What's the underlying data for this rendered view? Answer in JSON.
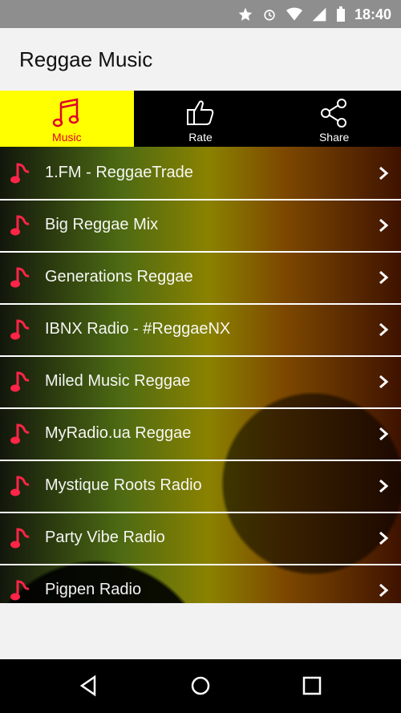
{
  "status": {
    "time": "18:40"
  },
  "app": {
    "title": "Reggae Music"
  },
  "tabs": [
    {
      "label": "Music",
      "active": true,
      "icon": "music-notes-icon"
    },
    {
      "label": "Rate",
      "active": false,
      "icon": "thumbs-up-icon"
    },
    {
      "label": "Share",
      "active": false,
      "icon": "share-icon"
    }
  ],
  "stations": [
    {
      "name": "1.FM - ReggaeTrade"
    },
    {
      "name": "Big Reggae Mix"
    },
    {
      "name": "Generations Reggae"
    },
    {
      "name": "IBNX Radio - #ReggaeNX"
    },
    {
      "name": "Miled Music Reggae"
    },
    {
      "name": "MyRadio.ua Reggae"
    },
    {
      "name": "Mystique Roots Radio"
    },
    {
      "name": "Party Vibe Radio"
    },
    {
      "name": "Pigpen Radio"
    }
  ],
  "colors": {
    "accent": "#ffff00",
    "noteRed": "#e0002a"
  }
}
